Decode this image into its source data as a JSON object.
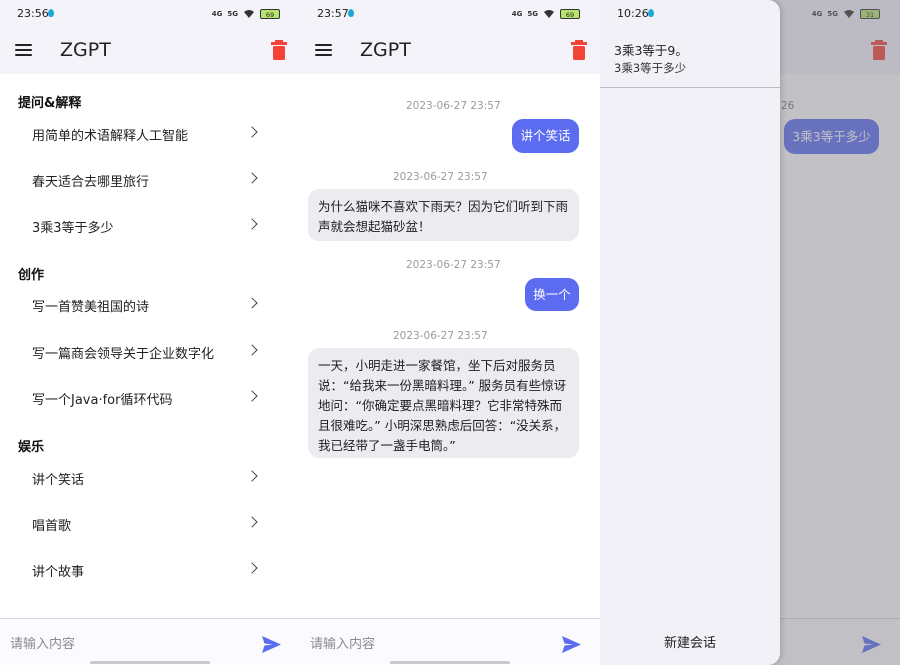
{
  "app": {
    "title": "ZGPT"
  },
  "colors": {
    "accent": "#5b6cf0",
    "delete": "#f44336",
    "battery": "#b9e36f"
  },
  "screens": [
    {
      "status": {
        "time": "23:56",
        "battery": "69",
        "signal1": "4G",
        "signal2": "5G"
      },
      "sections": [
        {
          "title": "提问&解释",
          "items": [
            "用简单的术语解释人工智能",
            "春天适合去哪里旅行",
            "3乘3等于多少"
          ]
        },
        {
          "title": "创作",
          "items": [
            "写一首赞美祖国的诗",
            "写一篇商会领导关于企业数字化",
            "写一个Java·for循环代码"
          ]
        },
        {
          "title": "娱乐",
          "items": [
            "讲个笑话",
            "唱首歌",
            "讲个故事"
          ]
        }
      ],
      "input_placeholder": "请输入内容"
    },
    {
      "status": {
        "time": "23:57",
        "battery": "69",
        "signal1": "4G",
        "signal2": "5G"
      },
      "messages": [
        {
          "time": "2023-06-27 23:57",
          "role": "user",
          "text": "讲个笑话"
        },
        {
          "time": "2023-06-27 23:57",
          "role": "bot",
          "text": "为什么猫咪不喜欢下雨天？因为它们听到下雨声就会想起猫砂盆！"
        },
        {
          "time": "2023-06-27 23:57",
          "role": "user",
          "text": "换一个"
        },
        {
          "time": "2023-06-27 23:57",
          "role": "bot",
          "text": "一天，小明走进一家餐馆，坐下后对服务员说：“给我来一份黑暗料理。” 服务员有些惊讶地问：“你确定要点黑暗料理？它非常特殊而且很难吃。” 小明深思熟虑后回答：“没关系，我已经带了一盏手电筒。”"
        }
      ],
      "input_placeholder": "请输入内容"
    },
    {
      "status": {
        "time": "10:26",
        "battery": "31",
        "signal1": "4G",
        "signal2": "5G"
      },
      "drawer": {
        "conversation_title": "3乘3等于9。",
        "conversation_subtitle": "3乘3等于多少",
        "new_chat": "新建会话"
      },
      "background": {
        "timestamp_fragment": "26",
        "bubble": "3乘3等于多少"
      }
    }
  ]
}
